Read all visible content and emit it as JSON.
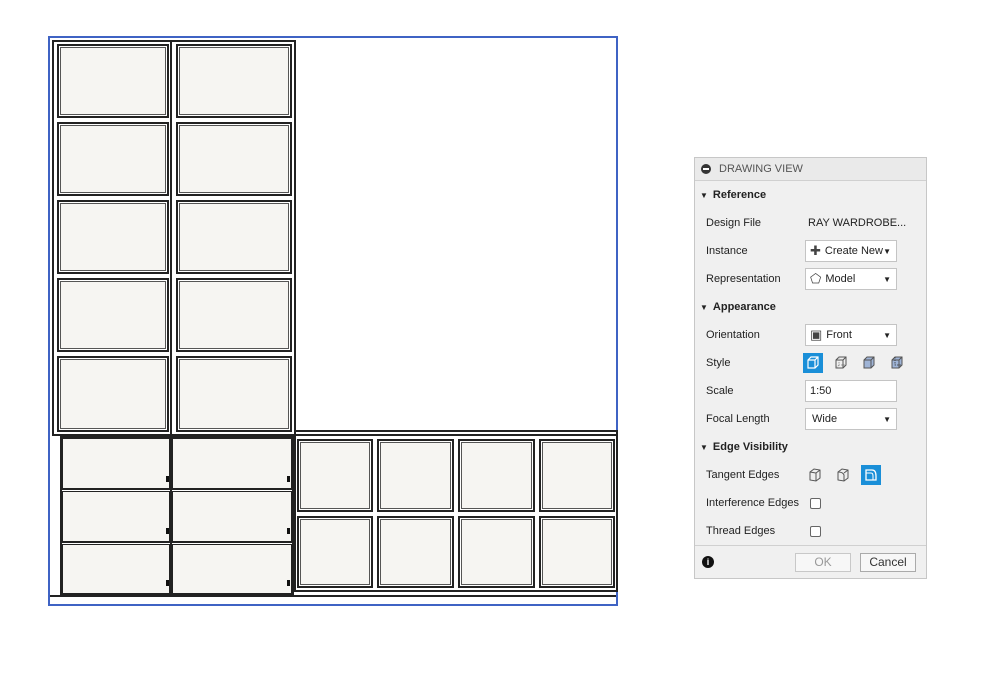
{
  "dialog": {
    "title": "DRAWING VIEW",
    "sections": {
      "reference": "Reference",
      "appearance": "Appearance",
      "edge_visibility": "Edge Visibility"
    },
    "design_file": {
      "label": "Design File",
      "value": "RAY WARDROBE..."
    },
    "instance": {
      "label": "Instance",
      "value": "Create New",
      "icon": "plus-outline-icon"
    },
    "representation": {
      "label": "Representation",
      "value": "Model",
      "icon": "model-icon"
    },
    "orientation": {
      "label": "Orientation",
      "value": "Front",
      "icon": "front-cube-icon"
    },
    "style": {
      "label": "Style",
      "options": [
        "visible-edges",
        "visible-and-hidden-edges",
        "shaded",
        "shaded-with-hidden-edges"
      ],
      "selected": "visible-edges"
    },
    "scale": {
      "label": "Scale",
      "value": "1:50"
    },
    "focal_length": {
      "label": "Focal Length",
      "value": "Wide"
    },
    "tangent_edges": {
      "label": "Tangent Edges",
      "options": [
        "tangent-off",
        "tangent-full",
        "tangent-shortened"
      ],
      "selected": "tangent-shortened"
    },
    "interference_edges": {
      "label": "Interference Edges",
      "checked": false
    },
    "thread_edges": {
      "label": "Thread Edges",
      "checked": false
    },
    "ok_label": "OK",
    "cancel_label": "Cancel"
  },
  "colors": {
    "selection_border": "#3f63c4",
    "selected_button": "#1a8fd8",
    "panel_fill": "#f6f5f2"
  }
}
